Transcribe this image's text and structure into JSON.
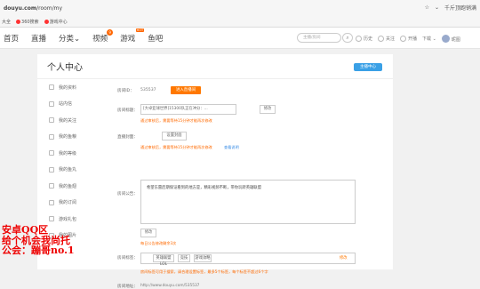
{
  "browser": {
    "url_host": "douyu.com",
    "url_path": "/room/my",
    "right_text": "千斤顶跑销满",
    "bookmarks": [
      "大全",
      "360搜索",
      "游戏中心"
    ]
  },
  "nav": {
    "items": [
      "首页",
      "直播",
      "分类",
      "视频",
      "游戏",
      "鱼吧"
    ],
    "video_badge": "9",
    "game_hot": "HOT",
    "search_placeholder": "主播/房间",
    "search_icon": "search-icon",
    "right_items": [
      "历史",
      "关注",
      "开播",
      "下载"
    ],
    "user_name": "昵图"
  },
  "page": {
    "title": "个人中心",
    "head_button": "主播中心"
  },
  "sidebar": {
    "items": [
      "我的资料",
      "站内信",
      "我的关注",
      "我的鱼粮",
      "我的等级",
      "我的鱼丸",
      "我的鱼翅",
      "我的订阅",
      "游戏礼包",
      "我的图片"
    ]
  },
  "main": {
    "room_id_label": "房间ID：",
    "room_id": "535537",
    "enter_button": "进入直播间",
    "room_title_label": "房间标题：",
    "room_title_value": "[大卓亚球世界]15300队正在冲分：...",
    "modify_button": "修改",
    "cover_label": "直播封面：",
    "cover_button": "设置封面",
    "cover_note": "通过审核后，需要等待15分钟才能再次修改",
    "cover_link": "查看说明",
    "title_note": "通过审核后，需要等待15分钟才能再次修改",
    "notice_label": "房间公告：",
    "notice_text": "希望东雷后期保证看到的地方是，精彩视频不断，带你玩转英雄联盟",
    "notice_modify": "修改",
    "notice_note": "每日公告修改剩余3次",
    "tags_label": "房间标签：",
    "tags": [
      "英雄联盟LOL",
      "竞技",
      "游戏攻略"
    ],
    "tags_edit": "修改",
    "tags_note": "房间标签可用于搜索，请合理设置标签，最多5个标签，每个标签不超过6个字",
    "url_label": "房间地址：",
    "url_value": "http://www.douyu.com/535537"
  },
  "overlay": {
    "lines": [
      "安卓QQ区",
      "给个机会我尚托",
      "公会：蹦哥no.1"
    ]
  }
}
